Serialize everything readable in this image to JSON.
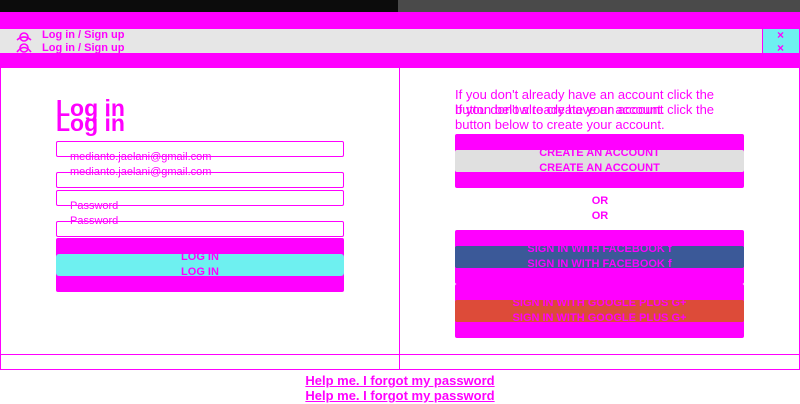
{
  "window": {
    "title": "Log in / Sign up",
    "close_glyph": "×",
    "icon": "user-avatar-icon"
  },
  "login": {
    "heading": "Log in",
    "email_value": "medianto.jaelani@gmail.com",
    "password_placeholder": "Password",
    "submit_label": "LOG IN"
  },
  "signup": {
    "prompt": "If you don't already have an account click the button below to create your account.",
    "create_label": "CREATE AN ACCOUNT",
    "or_label": "OR",
    "facebook_label": "SIGN IN WITH FACEBOOK",
    "facebook_icon": "f",
    "google_label": "SIGN IN WITH GOOGLE PLUS",
    "google_icon": "G+"
  },
  "footer": {
    "forgot_label": "Help me. I forgot my password"
  },
  "colors": {
    "accent": "#ff00ff",
    "login_button": "#6ef0f0",
    "create_button": "#e0e0e0",
    "facebook": "#3b5998",
    "google": "#dd4b39"
  }
}
